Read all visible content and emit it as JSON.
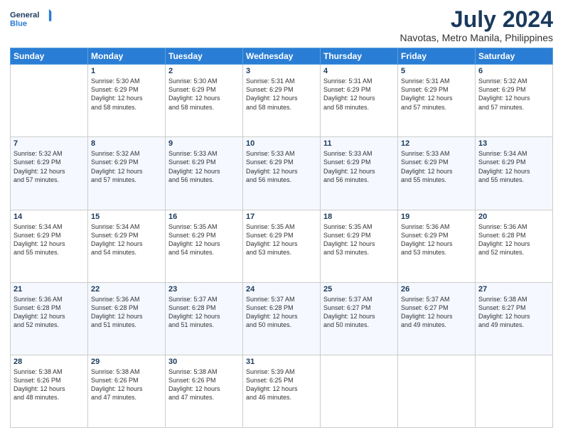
{
  "header": {
    "logo_line1": "General",
    "logo_line2": "Blue",
    "title": "July 2024",
    "subtitle": "Navotas, Metro Manila, Philippines"
  },
  "days_of_week": [
    "Sunday",
    "Monday",
    "Tuesday",
    "Wednesday",
    "Thursday",
    "Friday",
    "Saturday"
  ],
  "weeks": [
    [
      {
        "day": "",
        "info": ""
      },
      {
        "day": "1",
        "info": "Sunrise: 5:30 AM\nSunset: 6:29 PM\nDaylight: 12 hours\nand 58 minutes."
      },
      {
        "day": "2",
        "info": "Sunrise: 5:30 AM\nSunset: 6:29 PM\nDaylight: 12 hours\nand 58 minutes."
      },
      {
        "day": "3",
        "info": "Sunrise: 5:31 AM\nSunset: 6:29 PM\nDaylight: 12 hours\nand 58 minutes."
      },
      {
        "day": "4",
        "info": "Sunrise: 5:31 AM\nSunset: 6:29 PM\nDaylight: 12 hours\nand 58 minutes."
      },
      {
        "day": "5",
        "info": "Sunrise: 5:31 AM\nSunset: 6:29 PM\nDaylight: 12 hours\nand 57 minutes."
      },
      {
        "day": "6",
        "info": "Sunrise: 5:32 AM\nSunset: 6:29 PM\nDaylight: 12 hours\nand 57 minutes."
      }
    ],
    [
      {
        "day": "7",
        "info": "Sunrise: 5:32 AM\nSunset: 6:29 PM\nDaylight: 12 hours\nand 57 minutes."
      },
      {
        "day": "8",
        "info": "Sunrise: 5:32 AM\nSunset: 6:29 PM\nDaylight: 12 hours\nand 57 minutes."
      },
      {
        "day": "9",
        "info": "Sunrise: 5:33 AM\nSunset: 6:29 PM\nDaylight: 12 hours\nand 56 minutes."
      },
      {
        "day": "10",
        "info": "Sunrise: 5:33 AM\nSunset: 6:29 PM\nDaylight: 12 hours\nand 56 minutes."
      },
      {
        "day": "11",
        "info": "Sunrise: 5:33 AM\nSunset: 6:29 PM\nDaylight: 12 hours\nand 56 minutes."
      },
      {
        "day": "12",
        "info": "Sunrise: 5:33 AM\nSunset: 6:29 PM\nDaylight: 12 hours\nand 55 minutes."
      },
      {
        "day": "13",
        "info": "Sunrise: 5:34 AM\nSunset: 6:29 PM\nDaylight: 12 hours\nand 55 minutes."
      }
    ],
    [
      {
        "day": "14",
        "info": "Sunrise: 5:34 AM\nSunset: 6:29 PM\nDaylight: 12 hours\nand 55 minutes."
      },
      {
        "day": "15",
        "info": "Sunrise: 5:34 AM\nSunset: 6:29 PM\nDaylight: 12 hours\nand 54 minutes."
      },
      {
        "day": "16",
        "info": "Sunrise: 5:35 AM\nSunset: 6:29 PM\nDaylight: 12 hours\nand 54 minutes."
      },
      {
        "day": "17",
        "info": "Sunrise: 5:35 AM\nSunset: 6:29 PM\nDaylight: 12 hours\nand 53 minutes."
      },
      {
        "day": "18",
        "info": "Sunrise: 5:35 AM\nSunset: 6:29 PM\nDaylight: 12 hours\nand 53 minutes."
      },
      {
        "day": "19",
        "info": "Sunrise: 5:36 AM\nSunset: 6:29 PM\nDaylight: 12 hours\nand 53 minutes."
      },
      {
        "day": "20",
        "info": "Sunrise: 5:36 AM\nSunset: 6:28 PM\nDaylight: 12 hours\nand 52 minutes."
      }
    ],
    [
      {
        "day": "21",
        "info": "Sunrise: 5:36 AM\nSunset: 6:28 PM\nDaylight: 12 hours\nand 52 minutes."
      },
      {
        "day": "22",
        "info": "Sunrise: 5:36 AM\nSunset: 6:28 PM\nDaylight: 12 hours\nand 51 minutes."
      },
      {
        "day": "23",
        "info": "Sunrise: 5:37 AM\nSunset: 6:28 PM\nDaylight: 12 hours\nand 51 minutes."
      },
      {
        "day": "24",
        "info": "Sunrise: 5:37 AM\nSunset: 6:28 PM\nDaylight: 12 hours\nand 50 minutes."
      },
      {
        "day": "25",
        "info": "Sunrise: 5:37 AM\nSunset: 6:27 PM\nDaylight: 12 hours\nand 50 minutes."
      },
      {
        "day": "26",
        "info": "Sunrise: 5:37 AM\nSunset: 6:27 PM\nDaylight: 12 hours\nand 49 minutes."
      },
      {
        "day": "27",
        "info": "Sunrise: 5:38 AM\nSunset: 6:27 PM\nDaylight: 12 hours\nand 49 minutes."
      }
    ],
    [
      {
        "day": "28",
        "info": "Sunrise: 5:38 AM\nSunset: 6:26 PM\nDaylight: 12 hours\nand 48 minutes."
      },
      {
        "day": "29",
        "info": "Sunrise: 5:38 AM\nSunset: 6:26 PM\nDaylight: 12 hours\nand 47 minutes."
      },
      {
        "day": "30",
        "info": "Sunrise: 5:38 AM\nSunset: 6:26 PM\nDaylight: 12 hours\nand 47 minutes."
      },
      {
        "day": "31",
        "info": "Sunrise: 5:39 AM\nSunset: 6:25 PM\nDaylight: 12 hours\nand 46 minutes."
      },
      {
        "day": "",
        "info": ""
      },
      {
        "day": "",
        "info": ""
      },
      {
        "day": "",
        "info": ""
      }
    ]
  ]
}
